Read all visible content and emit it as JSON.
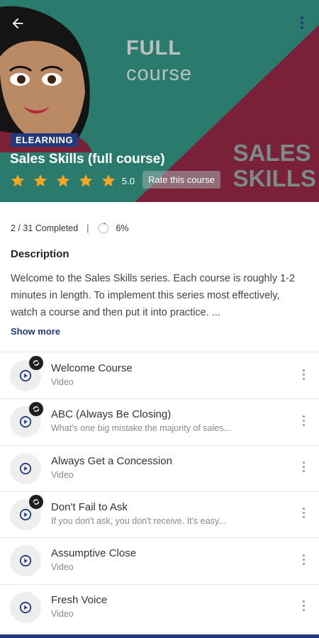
{
  "header": {
    "back_icon": "arrow-left-icon",
    "more_icon": "more-vertical-icon",
    "banner_text": {
      "line1": "FULL",
      "line2": "course",
      "corner_line1": "SALES",
      "corner_line2": "SKILLS"
    },
    "badge": "ELEARNING",
    "title": "Sales Skills (full course)",
    "rating": {
      "stars_filled": 5,
      "stars_total": 5,
      "value": "5.0"
    },
    "rate_button": "Rate this course"
  },
  "progress": {
    "completed": "2 / 31 Completed",
    "separator": "|",
    "percent": "6%",
    "fraction": 0.06
  },
  "description": {
    "heading": "Description",
    "text": "Welcome to the Sales Skills series. Each course is roughly 1-2 minutes in length. To implement this series most effectively, watch a course and then put it into practice. ...",
    "show_more": "Show more"
  },
  "items": [
    {
      "title": "Welcome Course",
      "subtitle": "Video",
      "completed": true
    },
    {
      "title": "ABC (Always Be Closing)",
      "subtitle": "What's one big mistake the majority of sales...",
      "completed": true
    },
    {
      "title": "Always Get a Concession",
      "subtitle": "Video",
      "completed": false
    },
    {
      "title": "Don't Fail to Ask",
      "subtitle": "If you don't ask, you don't receive. It's easy...",
      "completed": true
    },
    {
      "title": "Assumptive Close",
      "subtitle": "Video",
      "completed": false
    },
    {
      "title": "Fresh Voice",
      "subtitle": "Video",
      "completed": false
    }
  ],
  "colors": {
    "banner_teal": "#2a7a6e",
    "banner_maroon": "#7a2038",
    "brand_navy": "#223a7c",
    "star_gold": "#f6a623"
  }
}
